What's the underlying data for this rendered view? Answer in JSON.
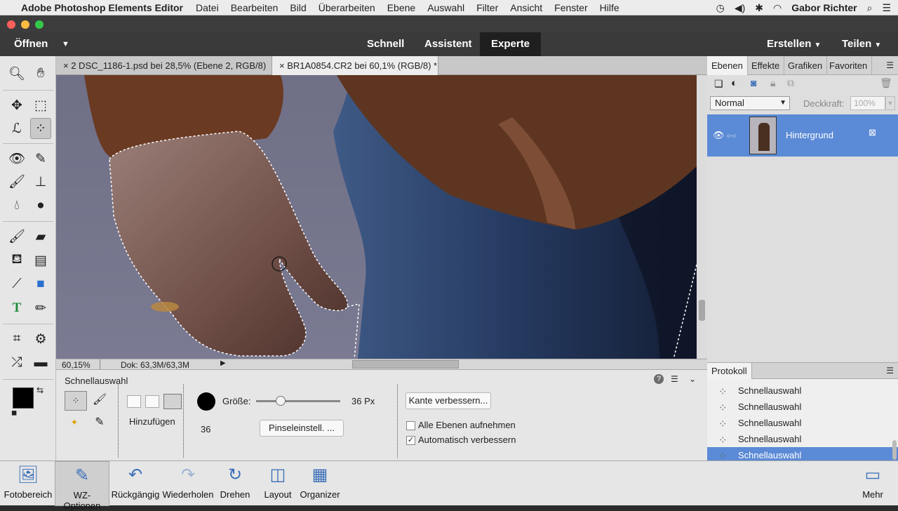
{
  "menubar": {
    "app_name": "Adobe Photoshop Elements Editor",
    "items": [
      "Datei",
      "Bearbeiten",
      "Bild",
      "Überarbeiten",
      "Ebene",
      "Auswahl",
      "Filter",
      "Ansicht",
      "Fenster",
      "Hilfe"
    ],
    "user": "Gabor Richter"
  },
  "appbar": {
    "open_label": "Öffnen",
    "modes": [
      "Schnell",
      "Assistent",
      "Experte"
    ],
    "active_mode": "Experte",
    "create_label": "Erstellen",
    "share_label": "Teilen"
  },
  "documents": {
    "tabs": [
      {
        "label": "2 DSC_1186-1.psd bei 28,5% (Ebene 2, RGB/8) *"
      },
      {
        "label": "BR1A0854.CR2 bei 60,1% (RGB/8) *"
      }
    ],
    "active_tab": 1
  },
  "status": {
    "zoom": "60,15%",
    "doc": "Dok: 63,3M/63,3M"
  },
  "options": {
    "title": "Schnellauswahl",
    "mode_label": "Hinzufügen",
    "size_label": "Größe:",
    "size_value": "36 Px",
    "brush_size": "36",
    "size_fraction": 0.29,
    "brush_settings_button": "Pinseleinstell. ...",
    "refine_edge_button": "Kante verbessern...",
    "sample_all_label": "Alle Ebenen aufnehmen",
    "sample_all_checked": false,
    "auto_enhance_label": "Automatisch verbessern",
    "auto_enhance_checked": true
  },
  "panel": {
    "tabs": [
      "Ebenen",
      "Effekte",
      "Grafiken",
      "Favoriten"
    ],
    "active_tab": "Ebenen",
    "blend_mode": "Normal",
    "opacity_label": "Deckkraft:",
    "opacity_value": "100%",
    "layers": [
      {
        "name": "Hintergrund",
        "selected": true
      }
    ]
  },
  "history": {
    "title": "Protokoll",
    "items": [
      "Schnellauswahl",
      "Schnellauswahl",
      "Schnellauswahl",
      "Schnellauswahl",
      "Schnellauswahl"
    ],
    "selected_index": 4
  },
  "bottombar": {
    "items": [
      "Fotobereich",
      "WZ-Optionen",
      "Rückgängig",
      "Wiederholen",
      "Drehen",
      "Layout",
      "Organizer"
    ],
    "selected": "WZ-Optionen",
    "more": "Mehr"
  },
  "colors": {
    "accent": "#5b8ad6",
    "mode_active_bg": "#1f1f1f"
  }
}
